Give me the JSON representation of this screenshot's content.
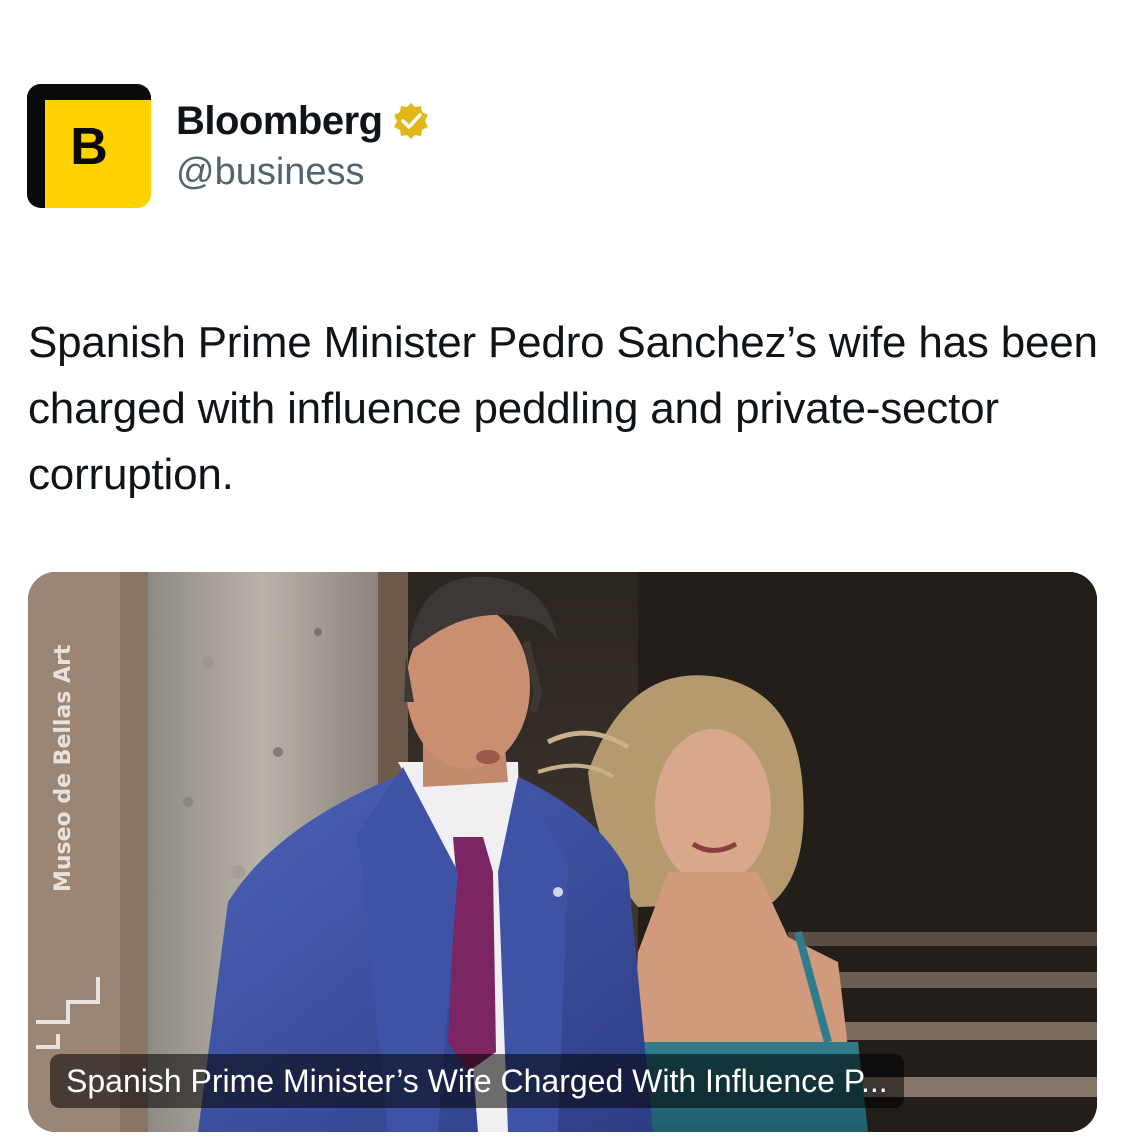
{
  "tweet": {
    "author": {
      "name": "Bloomberg",
      "handle": "@business",
      "avatar_letter": "B",
      "verified": true,
      "avatar_color": "#ffd200",
      "verified_color": "#e2b719"
    },
    "text": "Spanish Prime Minister Pedro Sanchez’s wife has been charged with influence peddling and private-sector corruption.",
    "card": {
      "title": "Spanish Prime Minister’s Wife Charged With Influence P...",
      "photo_sign_text": "Museo de Bellas Art"
    }
  },
  "icons": {
    "back": "chevron-down-icon",
    "verified": "verified-badge-icon"
  }
}
